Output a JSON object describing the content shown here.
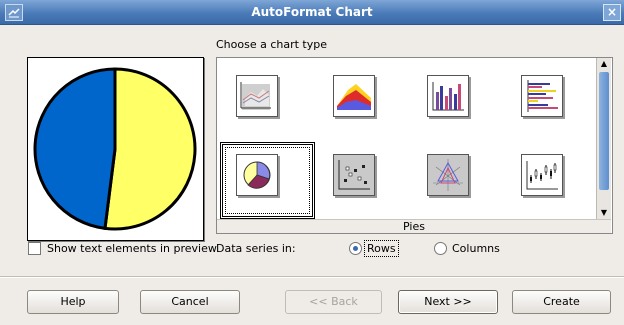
{
  "window": {
    "title": "AutoFormat Chart",
    "close_glyph": "×"
  },
  "gallery": {
    "heading": "Choose a chart type",
    "category_label": "Pies",
    "selected_type": "pie-3d",
    "chart_types": [
      {
        "icon": "area-3d-icon",
        "selected": false
      },
      {
        "icon": "area-stacked-icon",
        "selected": false
      },
      {
        "icon": "column-3d-icon",
        "selected": false
      },
      {
        "icon": "bar-icon",
        "selected": false
      },
      {
        "icon": "pie-3d-icon",
        "selected": true
      },
      {
        "icon": "xy-scatter-icon",
        "selected": false
      },
      {
        "icon": "net-icon",
        "selected": false
      },
      {
        "icon": "stock-icon",
        "selected": false
      }
    ]
  },
  "preview": {
    "slices": [
      {
        "color": "#ffff66",
        "fraction": 0.52
      },
      {
        "color": "#0066cc",
        "fraction": 0.48
      }
    ]
  },
  "options": {
    "show_text_label": "Show text elements in preview",
    "show_text_checked": false,
    "data_series_label": "Data series in:",
    "rows_label": "Rows",
    "columns_label": "Columns",
    "data_series_selected": "Rows"
  },
  "buttons": {
    "help": "Help",
    "cancel": "Cancel",
    "back": "<< Back",
    "next": "Next >>",
    "create": "Create"
  },
  "colors": {
    "title_bar": "#4a7bb8",
    "dialog_bg": "#efebe7",
    "selection_accent": "#3a6ab0"
  }
}
